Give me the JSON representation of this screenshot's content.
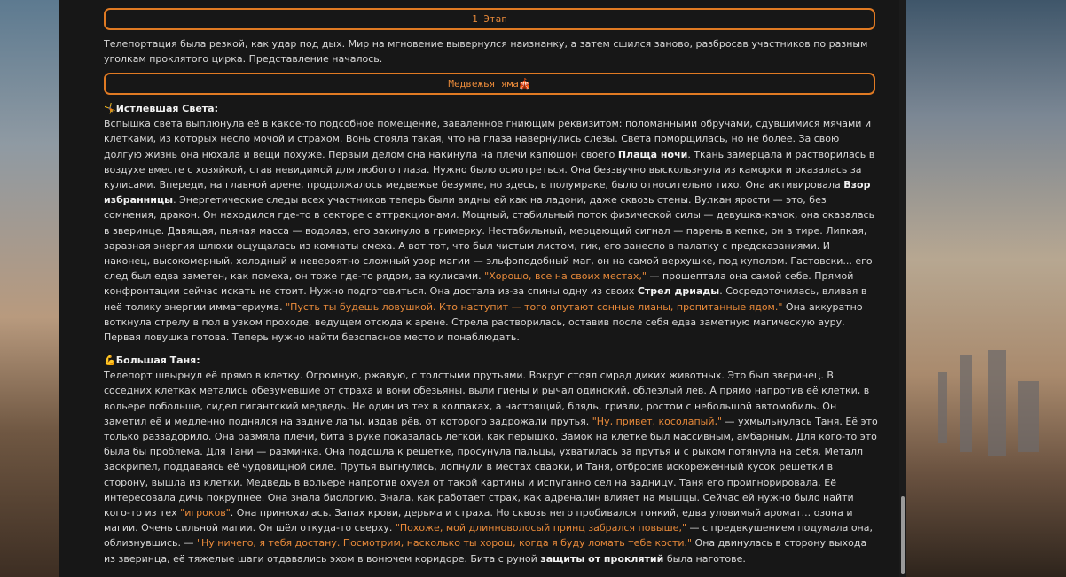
{
  "stage": {
    "title": "1 Этап"
  },
  "intro": "Телепортация была резкой, как удар под дых. Мир на мгновение вывернулся наизнанку, а затем сшился заново, разбросав участников по разным уголкам проклятого цирка. Представление началось.",
  "location": {
    "title": "Медвежья яма🎪"
  },
  "sveta": {
    "icon": "🤸",
    "name": "Истлевшая Света:",
    "t1": "Вспышка света выплюнула её в какое-то подсобное помещение, заваленное гниющим реквизитом: поломанными обручами, сдувшимися мячами и клетками, из которых несло мочой и страхом. Вонь стояла такая, что на глаза навернулись слезы. Света поморщилась, но не более. За свою долгую жизнь она нюхала и вещи похуже. Первым делом она накинула на плечи капюшон своего ",
    "b1": "Плаща ночи",
    "t2": ". Ткань замерцала и растворилась в воздухе вместе с хозяйкой, став невидимой для любого глаза. Нужно было осмотреться. Она беззвучно выскользнула из каморки и оказалась за кулисами. Впереди, на главной арене, продолжалось медвежье безумие, но здесь, в полумраке, было относительно тихо. Она активировала ",
    "b2": "Взор избранницы",
    "t3": ". Энергетические следы всех участников теперь были видны ей как на ладони, даже сквозь стены. Вулкан ярости — это, без сомнения, дракон. Он находился где-то в секторе с аттракционами. Мощный, стабильный поток физической силы — девушка-качок, она оказалась в зверинце. Давящая, пьяная масса — водолаз, его закинуло в гримерку. Нестабильный, мерцающий сигнал — парень в кепке, он в тире. Липкая, заразная энергия шлюхи ощущалась из комнаты смеха. А вот тот, что был чистым листом, гик, его занесло в палатку с предсказаниями. И наконец, высокомерный, холодный и невероятно сложный узор магии — эльфоподобный маг, он на самой верхушке, под куполом. Гастовски... его след был едва заметен, как помеха, он тоже где-то рядом, за кулисами. ",
    "q1": "\"Хорошо, все на своих местах,\"",
    "t4": " — прошептала она самой себе. Прямой конфронтации сейчас искать не стоит. Нужно подготовиться. Она достала из-за спины одну из своих ",
    "b3": "Стрел дриады",
    "t5": ". Сосредоточилась, вливая в неё толику энергии имматериума. ",
    "q2": "\"Пусть ты будешь ловушкой. Кто наступит — того опутают сонные лианы, пропитанные ядом.\"",
    "t6": " Она аккуратно воткнула стрелу в пол в узком проходе, ведущем отсюда к арене. Стрела растворилась, оставив после себя едва заметную магическую ауру. Первая ловушка готова. Теперь нужно найти безопасное место и понаблюдать."
  },
  "tanya": {
    "icon": "💪",
    "name": "Большая Таня:",
    "t1": "Телепорт швырнул её прямо в клетку. Огромную, ржавую, с толстыми прутьями. Вокруг стоял смрад диких животных. Это был зверинец. В соседних клетках метались обезумевшие от страха и вони обезьяны, выли гиены и рычал одинокий, облезлый лев. А прямо напротив её клетки, в вольере побольше, сидел гигантский медведь. Не один из тех в колпаках, а настоящий, блядь, гризли, ростом с небольшой автомобиль. Он заметил её и медленно поднялся на задние лапы, издав рёв, от которого задрожали прутья. ",
    "q1": "\"Ну, привет, косолапый,\"",
    "t2": " — ухмыльнулась Таня. Её это только раззадорило. Она размяла плечи, бита в руке показалась легкой, как перышко. Замок на клетке был массивным, амбарным. Для кого-то это была бы проблема. Для Тани — разминка. Она подошла к решетке, просунула пальцы, ухватилась за прутья и с рыком потянула на себя. Металл заскрипел, поддаваясь её чудовищной силе. Прутья выгнулись, лопнули в местах сварки, и Таня, отбросив искореженный кусок решетки в сторону, вышла из клетки. Медведь в вольере напротив охуел от такой картины и испуганно сел на задницу. Таня его проигнорировала. Её интересовала дичь покрупнее. Она знала биологию. Знала, как работает страх, как адреналин влияет на мышцы. Сейчас ей нужно было найти кого-то из тех ",
    "q2": "\"игроков\"",
    "t3": ". Она принюхалась. Запах крови, дерьма и страха. Но сквозь него пробивался тонкий, едва уловимый аромат... озона и магии. Очень сильной магии. Он шёл откуда-то сверху. ",
    "q3": "\"Похоже, мой длинноволосый принц забрался повыше,\"",
    "t4": " — с предвкушением подумала она, облизнувшись. — ",
    "q4": "\"Ну ничего, я тебя достану. Посмотрим, насколько ты хорош, когда я буду ломать тебе кости.\"",
    "t5": " Она двинулась в сторону выхода из зверинца, её тяжелые шаги отдавались эхом в вонючем коридоре. Бита с руной ",
    "b1": "защиты от проклятий",
    "t6": " была наготове."
  }
}
